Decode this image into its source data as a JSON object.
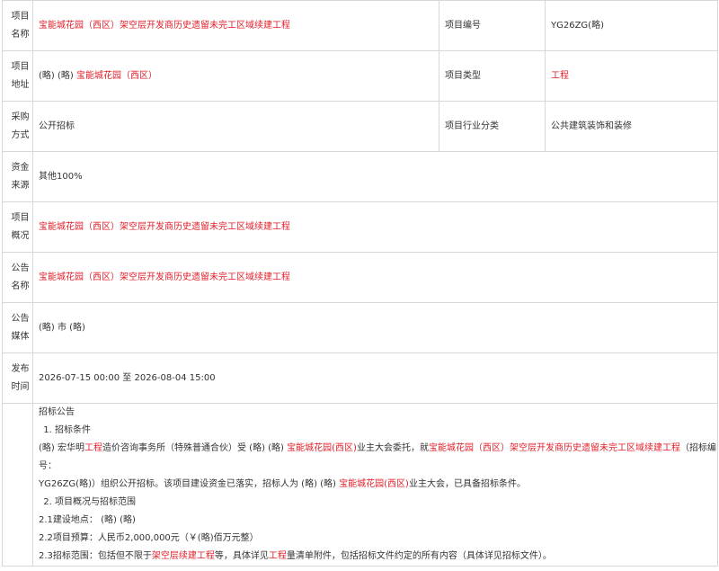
{
  "rows": {
    "project_name": {
      "label": "项目名称",
      "value": "宝能城花园（西区）架空层开发商历史遗留未完工区域续建工程"
    },
    "project_no": {
      "label": "项目编号",
      "value": "YG26ZG(略)"
    },
    "project_addr": {
      "label": "项目地址",
      "prefix": "(略) (略) ",
      "value": "宝能城花园（西区）"
    },
    "project_type": {
      "label": "项目类型",
      "value": "工程"
    },
    "purchase_method": {
      "label": "采购方式",
      "value": "公开招标"
    },
    "industry": {
      "label": "项目行业分类",
      "value": "公共建筑装饰和装修"
    },
    "fund_source": {
      "label": "资金来源",
      "value": "其他100%"
    },
    "overview": {
      "label": "项目概况",
      "value": "宝能城花园（西区）架空层开发商历史遗留未完工区域续建工程"
    },
    "notice_name": {
      "label": "公告名称",
      "value": "宝能城花园（西区）架空层开发商历史遗留未完工区域续建工程"
    },
    "media": {
      "label": "公告媒体",
      "value": "(略) 市 (略)"
    },
    "publish_time": {
      "label": "发布时间",
      "value": "2026-07-15 00:00 至 2026-08-04 15:00"
    }
  },
  "notice": {
    "title": "招标公告",
    "s1_title": "招标条件",
    "s1_a": "(略) 宏华明",
    "s1_b": "工程",
    "s1_c": "造价咨询事务所（特殊普通合伙）受 (略) (略) ",
    "s1_d": "宝能城花园(西区)",
    "s1_e": "业主大会委托，就",
    "s1_f": "宝能城花园（西区）架空层开发商历史遗留未完工区域续建工程",
    "s1_g": "（招标编号：",
    "s1_h": "YG26ZG(略)）组织公开招标。该项目建设资金已落实，招标人为 (略) (略) ",
    "s1_i": "宝能城花园(西区)",
    "s1_j": "业主大会，已具备招标条件。",
    "s2_title": "项目概况与招标范围",
    "s2_1": "2.1建设地点： (略) (略)",
    "s2_2": "2.2项目预算：人民币2,000,000元（￥(略)佰万元整）",
    "s2_3a": "2.3招标范围：包括但不限于",
    "s2_3b": "架空层续建工程",
    "s2_3c": "等，具体详见",
    "s2_3d": "工程",
    "s2_3e": "量清单附件，包括招标文件约定的所有内容（具体详见招标文件）。"
  }
}
